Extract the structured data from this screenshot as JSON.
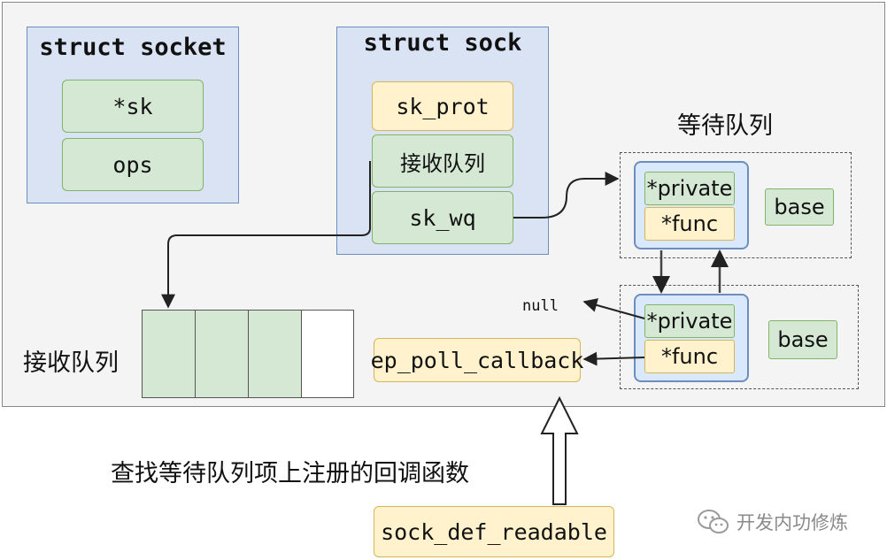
{
  "struct_socket": {
    "title": "struct socket",
    "fields": [
      "*sk",
      "ops"
    ]
  },
  "struct_sock": {
    "title": "struct sock",
    "fields": [
      "sk_prot",
      "接收队列",
      "sk_wq"
    ]
  },
  "wait_queue": {
    "label": "等待队列",
    "entries": [
      {
        "private_label": "*private",
        "func_label": "*func",
        "base_label": "base"
      },
      {
        "private_label": "*private",
        "func_label": "*func",
        "base_label": "base"
      }
    ],
    "null_label": "null"
  },
  "receive_queue": {
    "label": "接收队列",
    "filled_cells": 3,
    "total_cells": 4
  },
  "callback": {
    "label": "ep_poll_callback"
  },
  "lookup_caption": "查找等待队列项上注册的回调函数",
  "trigger": {
    "label": "sock_def_readable"
  },
  "watermark": {
    "text": "开发内功修炼"
  },
  "colors": {
    "struct_fill": "#dae3f3",
    "field_green": "#d5e8d4",
    "field_yellow": "#fff2cc",
    "node_fill": "#dae8fc"
  }
}
